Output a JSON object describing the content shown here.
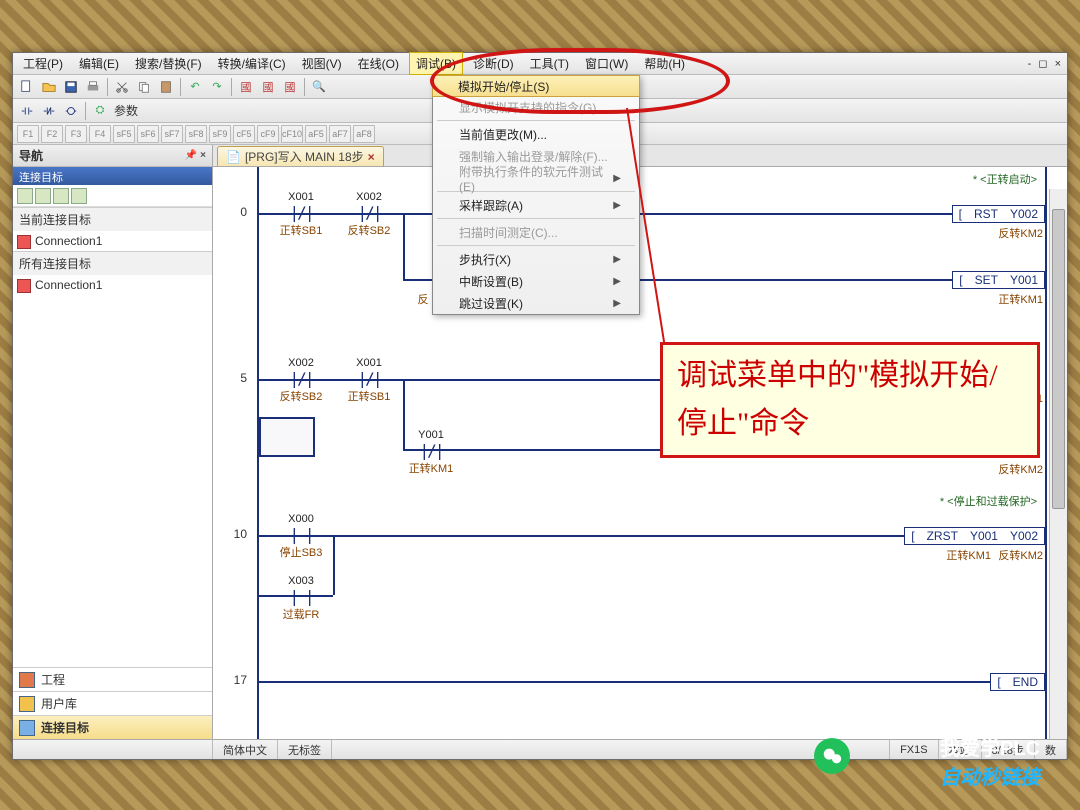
{
  "menubar": {
    "items": [
      "工程(P)",
      "编辑(E)",
      "搜索/替换(F)",
      "转换/编译(C)",
      "视图(V)",
      "在线(O)",
      "调试(B)",
      "诊断(D)",
      "工具(T)",
      "窗口(W)",
      "帮助(H)"
    ],
    "highlight_index": 6,
    "wctrl": "- ◻ ×"
  },
  "toolbar2_label": "参数",
  "sidebar": {
    "title": "导航",
    "bluebar": "连接目标",
    "section1": {
      "hd": "当前连接目标",
      "item": "Connection1"
    },
    "section2": {
      "hd": "所有连接目标",
      "item": "Connection1"
    },
    "cats": [
      "工程",
      "用户库",
      "连接目标"
    ],
    "active_cat": 2
  },
  "tab": {
    "label": "[PRG]写入 MAIN 18步"
  },
  "dropdown": {
    "items": [
      {
        "label": "模拟开始/停止(S)",
        "hl": true,
        "icon": true
      },
      {
        "label": "显示模拟开支持的指令(G)",
        "disabled": true,
        "sepAfter": true
      },
      {
        "label": "当前值更改(M)...",
        "icon": true
      },
      {
        "label": "强制输入输出登录/解除(F)...",
        "disabled": true
      },
      {
        "label": "附带执行条件的软元件测试(E)",
        "arrow": true,
        "disabled": true,
        "sepAfter": true
      },
      {
        "label": "采样跟踪(A)",
        "arrow": true,
        "sepAfter": true
      },
      {
        "label": "扫描时间测定(C)...",
        "disabled": true,
        "sepAfter": true
      },
      {
        "label": "步执行(X)",
        "arrow": true
      },
      {
        "label": "中断设置(B)",
        "arrow": true
      },
      {
        "label": "跳过设置(K)",
        "arrow": true
      }
    ]
  },
  "annotation": "调试菜单中的\"模拟开始/停止\"命令",
  "ladder": {
    "comments": {
      "c0": "* <正转启动>",
      "c5": "* <停止和过载保护>"
    },
    "rungs": [
      {
        "step": "0",
        "contacts": [
          {
            "dev": "X001",
            "sym": "|/|",
            "under": "正转SB1"
          },
          {
            "dev": "X002",
            "sym": "|/|",
            "under": "反转SB2"
          }
        ],
        "out": {
          "op": "RST",
          "dev": "Y002",
          "under": "反转KM2"
        }
      },
      {
        "step": "",
        "contacts": [
          {
            "dev": "",
            "sym": "",
            "under": "反"
          }
        ],
        "out": {
          "op": "SET",
          "dev": "Y001",
          "under": "正转KM1"
        }
      },
      {
        "step": "5",
        "contacts": [
          {
            "dev": "X002",
            "sym": "|/|",
            "under": "反转SB2"
          },
          {
            "dev": "X001",
            "sym": "|/|",
            "under": "正转SB1"
          }
        ],
        "out": {
          "op2": "",
          "dev2": "",
          "under": "1"
        }
      },
      {
        "step": "",
        "contacts": [
          {
            "dev": "Y001",
            "sym": "|/|",
            "under": "正转KM1"
          }
        ],
        "out": {
          "under": "反转KM2"
        }
      },
      {
        "step": "10",
        "contacts": [
          {
            "dev": "X000",
            "sym": "| |",
            "under": "停止SB3"
          }
        ],
        "out": {
          "op": "ZRST",
          "dev": "Y001",
          "dev2": "Y002",
          "under": "正转KM1",
          "under2": "反转KM2"
        }
      },
      {
        "step": "",
        "contacts": [
          {
            "dev": "X003",
            "sym": "| |",
            "under": "过载FR"
          }
        ]
      },
      {
        "step": "17",
        "out": {
          "op": "END"
        }
      }
    ]
  },
  "statusbar": {
    "cells": [
      "简体中文",
      "无标签",
      "",
      "FX1S",
      "本站",
      "8/18步",
      "数"
    ]
  },
  "watermark": {
    "l1": "我爱学PLC",
    "l2": "自动秒链接"
  }
}
